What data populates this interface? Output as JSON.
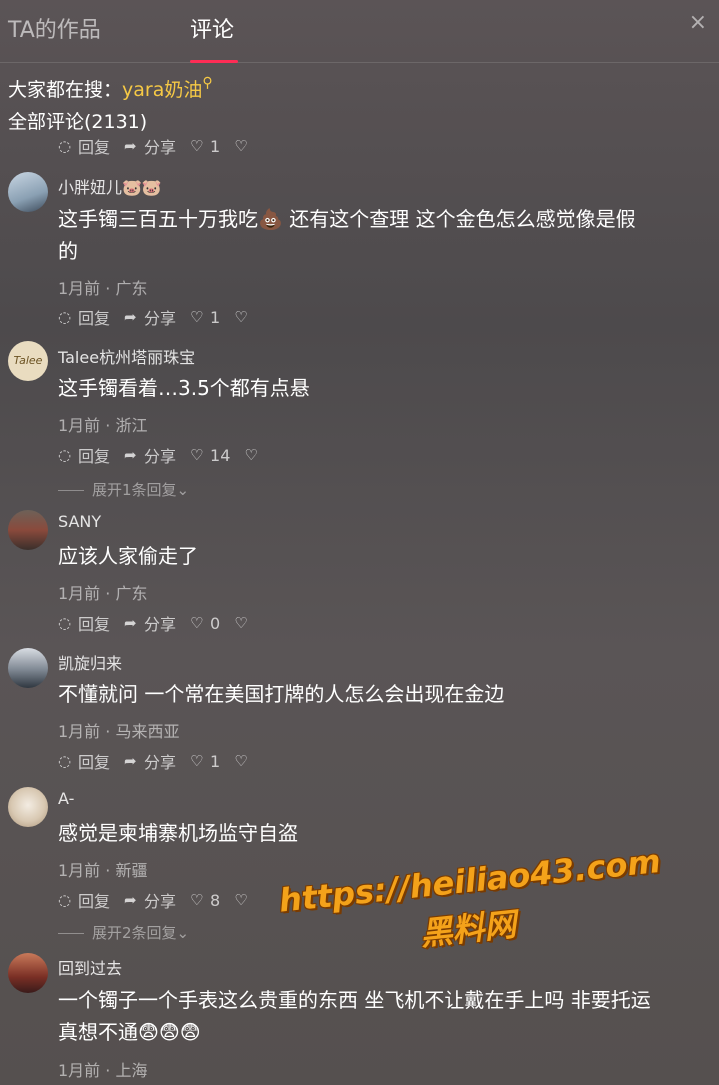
{
  "tabs": {
    "works": "TA的作品",
    "comments": "评论"
  },
  "close": "×",
  "search": {
    "prefix": "大家都在搜：",
    "keyword": "yara奶油"
  },
  "comment_count": "全部评论(2131)",
  "top_actions": {
    "reply": "回复",
    "share": "分享",
    "likes": "1"
  },
  "comments": [
    {
      "user": "小胖妞儿🐷🐷",
      "text_line1": "这手镯三百五十万我吃💩 还有这个查理 这个金色怎么感觉像是假",
      "text_line2": "的",
      "meta": "1月前 · 广东",
      "reply": "回复",
      "share": "分享",
      "likes": "1"
    },
    {
      "user": "Talee杭州塔丽珠宝",
      "avatar_text": "Talee",
      "text_line1": "这手镯看着…3.5个都有点悬",
      "meta": "1月前 · 浙江",
      "reply": "回复",
      "share": "分享",
      "likes": "14",
      "expand": "展开1条回复"
    },
    {
      "user": "SANY",
      "text_line1": "应该人家偷走了",
      "meta": "1月前 · 广东",
      "reply": "回复",
      "share": "分享",
      "likes": "0"
    },
    {
      "user": "凯旋归来",
      "text_line1": "不懂就问 一个常在美国打牌的人怎么会出现在金边",
      "meta": "1月前 · 马来西亚",
      "reply": "回复",
      "share": "分享",
      "likes": "1"
    },
    {
      "user": "A-",
      "text_line1": "感觉是柬埔寨机场监守自盗",
      "meta": "1月前 · 新疆",
      "reply": "回复",
      "share": "分享",
      "likes": "8",
      "expand": "展开2条回复"
    },
    {
      "user": "回到过去",
      "text_line1": "一个镯子一个手表这么贵重的东西 坐飞机不让戴在手上吗 非要托运",
      "text_line2": "真想不通😨😨😨",
      "meta": "1月前 · 上海"
    }
  ],
  "watermark": {
    "url": "https://heiliao43.com",
    "name": "黑料网"
  },
  "colors": {
    "accent": "#fe2c55",
    "keyword": "#f6c945",
    "watermark": "#f4a21a"
  }
}
